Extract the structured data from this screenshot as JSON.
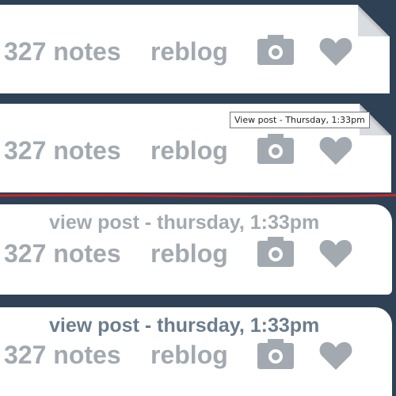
{
  "post_footer": {
    "notes_label": "327 notes",
    "reblog_label": "reblog",
    "camera_icon": "camera-icon",
    "heart_icon": "heart-icon"
  },
  "tooltip": {
    "text": "View post - Thursday, 1:33pm"
  },
  "view_post_link": {
    "text": "view post - thursday, 1:33pm"
  },
  "colors": {
    "background": "#2e4155",
    "panel": "#ffffff",
    "footer_text": "#a3a9b0",
    "link_hover": "#6b7d8d",
    "divider": "#e02020"
  }
}
